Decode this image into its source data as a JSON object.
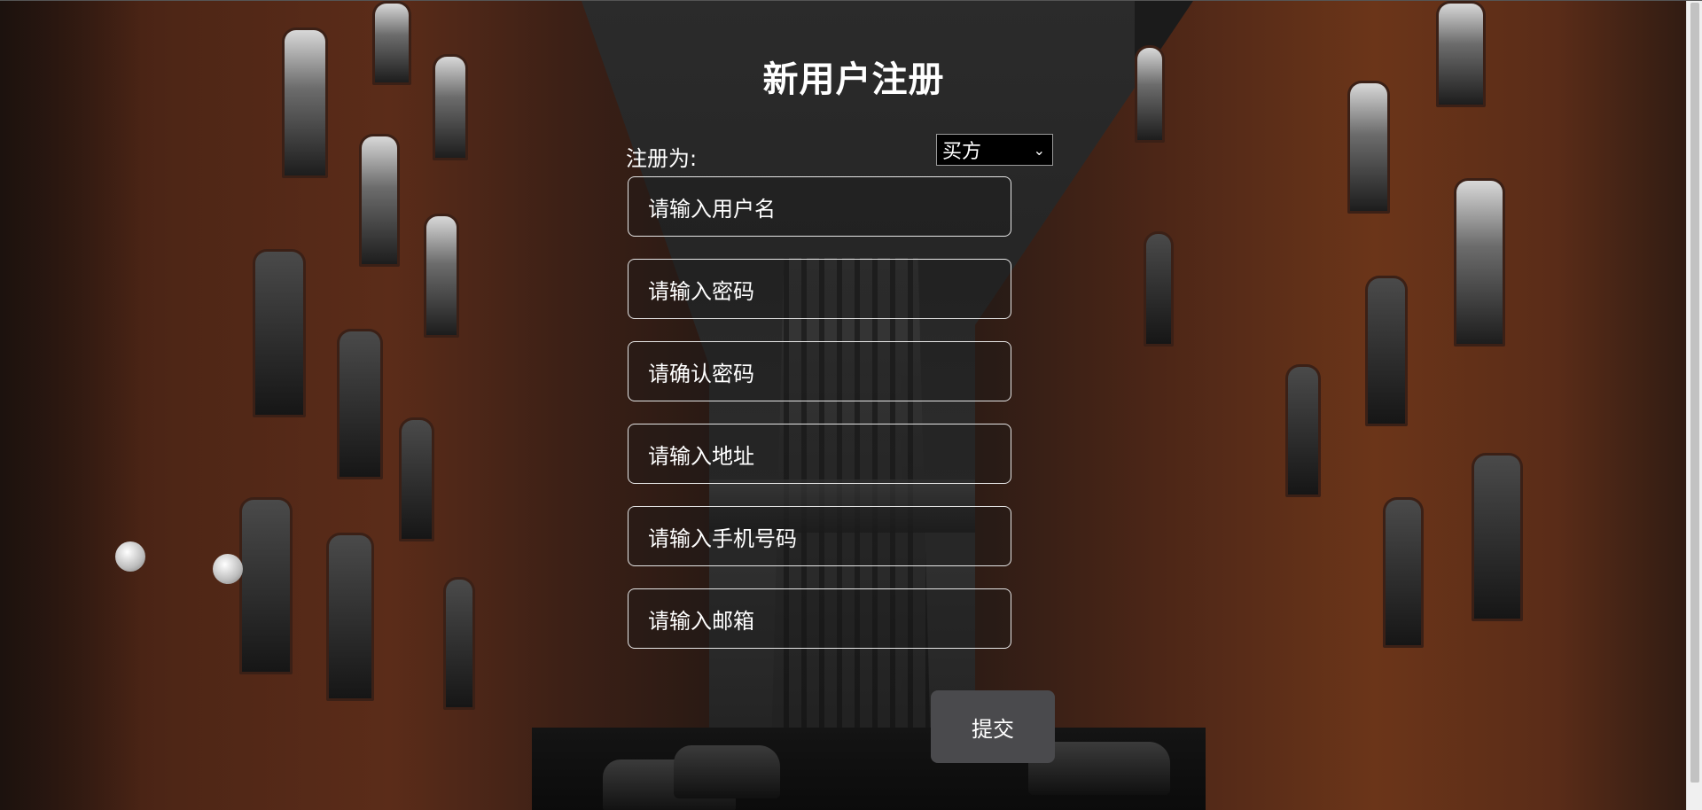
{
  "form": {
    "title": "新用户注册",
    "role_label": "注册为:",
    "role_selected": "买方",
    "fields": [
      {
        "placeholder": "请输入用户名"
      },
      {
        "placeholder": "请输入密码"
      },
      {
        "placeholder": "请确认密码"
      },
      {
        "placeholder": "请输入地址"
      },
      {
        "placeholder": "请输入手机号码"
      },
      {
        "placeholder": "请输入邮箱"
      }
    ],
    "submit_label": "提交"
  },
  "icons": {
    "select_caret": "chevron-down-icon"
  },
  "colors": {
    "text": "#ffffff",
    "submit_bg": "#4a4a4d",
    "field_border": "#e6e6e6",
    "select_bg": "#000000"
  }
}
